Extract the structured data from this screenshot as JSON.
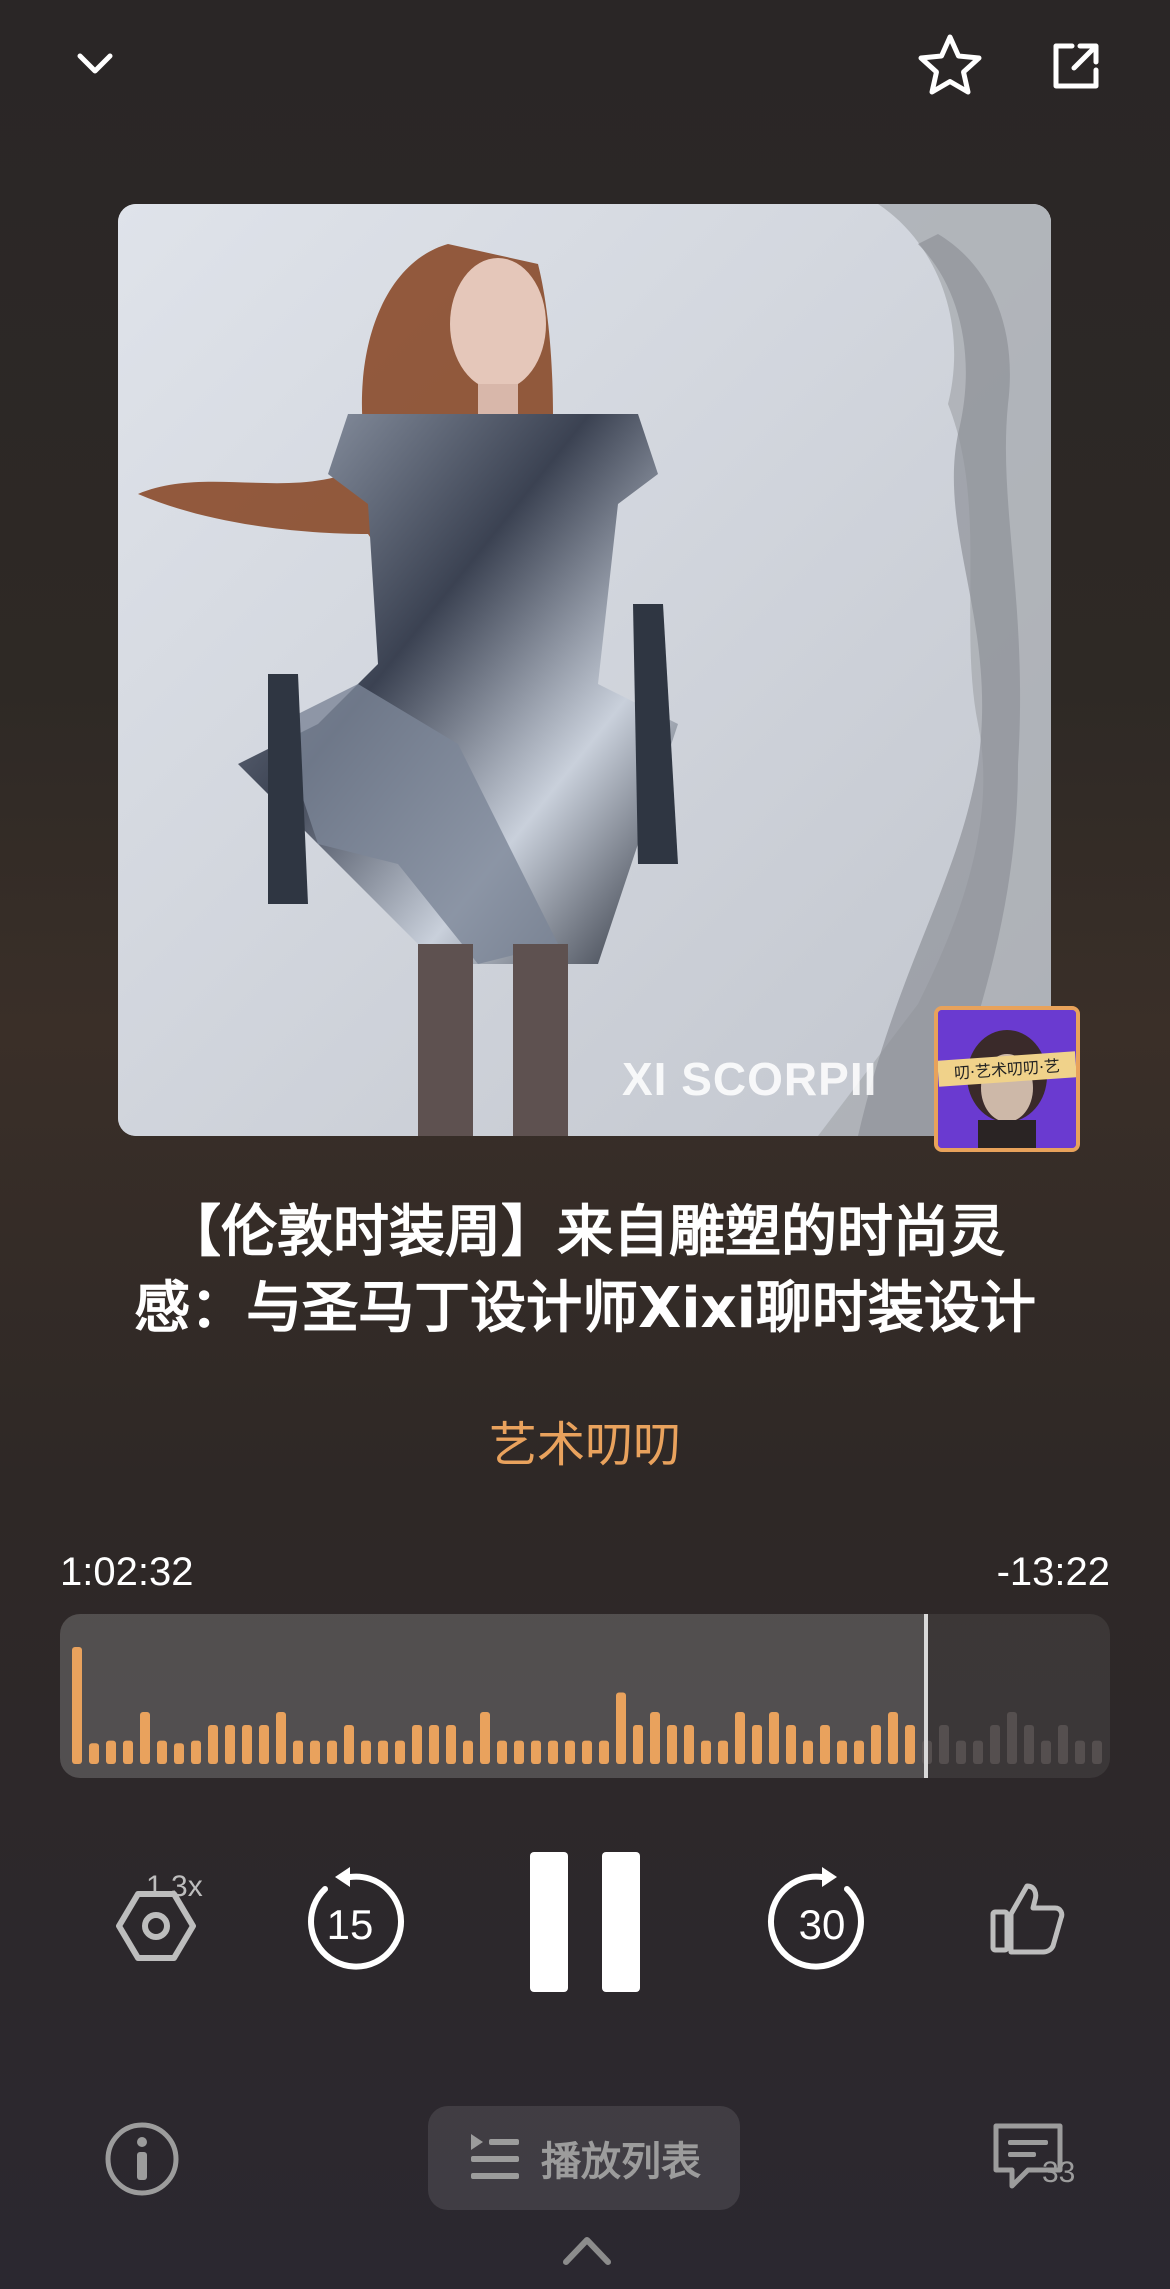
{
  "header": {
    "collapse_icon": "chevron-down-icon",
    "favorite_icon": "star-outline-icon",
    "share_icon": "share-icon"
  },
  "cover": {
    "watermark": "XI SCORPII",
    "badge_text": "叨·艺术叨叨·艺"
  },
  "episode": {
    "title": "【伦敦时装周】来自雕塑的时尚灵感：与圣马丁设计师Xixi聊时装设计",
    "channel": "艺术叨叨"
  },
  "player": {
    "elapsed": "1:02:32",
    "remaining": "-13:22",
    "progress": 0.825,
    "waveform": [
      0.9,
      0.16,
      0.18,
      0.18,
      0.4,
      0.18,
      0.16,
      0.18,
      0.3,
      0.3,
      0.3,
      0.3,
      0.4,
      0.18,
      0.18,
      0.18,
      0.3,
      0.18,
      0.18,
      0.18,
      0.3,
      0.3,
      0.3,
      0.18,
      0.4,
      0.18,
      0.18,
      0.18,
      0.18,
      0.18,
      0.18,
      0.18,
      0.55,
      0.3,
      0.4,
      0.3,
      0.3,
      0.18,
      0.18,
      0.4,
      0.3
    ],
    "speed_label": "1.3x",
    "rewind_seconds": "15",
    "forward_seconds": "30"
  },
  "bottom": {
    "playlist_label": "播放列表",
    "comments_count": "33"
  },
  "colors": {
    "accent": "#e9a25d",
    "wave_played": "#e9a25d",
    "wave_unplayed": "#6b6563"
  }
}
